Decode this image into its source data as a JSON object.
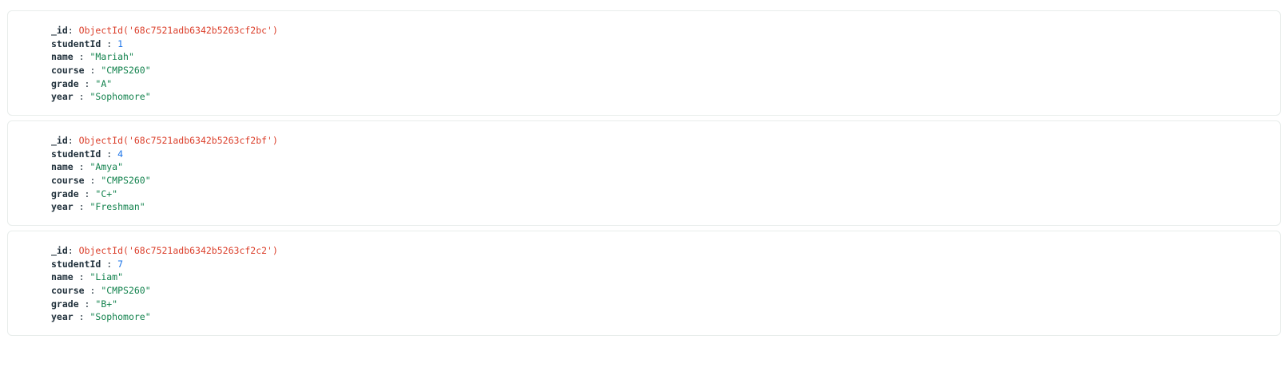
{
  "documents": [
    {
      "fields": [
        {
          "key": "_id",
          "sep": ": ",
          "value": "ObjectId('68c7521adb6342b5263cf2bc')",
          "type": "oid"
        },
        {
          "key": "studentId",
          "sep": " : ",
          "value": "1",
          "type": "num"
        },
        {
          "key": "name",
          "sep": " : ",
          "value": "\"Mariah\"",
          "type": "str"
        },
        {
          "key": "course",
          "sep": " : ",
          "value": "\"CMPS260\"",
          "type": "str"
        },
        {
          "key": "grade",
          "sep": " : ",
          "value": "\"A\"",
          "type": "str"
        },
        {
          "key": "year",
          "sep": " : ",
          "value": "\"Sophomore\"",
          "type": "str"
        }
      ]
    },
    {
      "fields": [
        {
          "key": "_id",
          "sep": ": ",
          "value": "ObjectId('68c7521adb6342b5263cf2bf')",
          "type": "oid"
        },
        {
          "key": "studentId",
          "sep": " : ",
          "value": "4",
          "type": "num"
        },
        {
          "key": "name",
          "sep": " : ",
          "value": "\"Amya\"",
          "type": "str"
        },
        {
          "key": "course",
          "sep": " : ",
          "value": "\"CMPS260\"",
          "type": "str"
        },
        {
          "key": "grade",
          "sep": " : ",
          "value": "\"C+\"",
          "type": "str"
        },
        {
          "key": "year",
          "sep": " : ",
          "value": "\"Freshman\"",
          "type": "str"
        }
      ]
    },
    {
      "fields": [
        {
          "key": "_id",
          "sep": ": ",
          "value": "ObjectId('68c7521adb6342b5263cf2c2')",
          "type": "oid"
        },
        {
          "key": "studentId",
          "sep": " : ",
          "value": "7",
          "type": "num"
        },
        {
          "key": "name",
          "sep": " : ",
          "value": "\"Liam\"",
          "type": "str"
        },
        {
          "key": "course",
          "sep": " : ",
          "value": "\"CMPS260\"",
          "type": "str"
        },
        {
          "key": "grade",
          "sep": " : ",
          "value": "\"B+\"",
          "type": "str"
        },
        {
          "key": "year",
          "sep": " : ",
          "value": "\"Sophomore\"",
          "type": "str"
        }
      ]
    }
  ],
  "colors": {
    "objectid": "#db3e2a",
    "number": "#1a73e8",
    "string": "#12824d",
    "key": "#21313c",
    "card_border": "#e8edeb"
  }
}
